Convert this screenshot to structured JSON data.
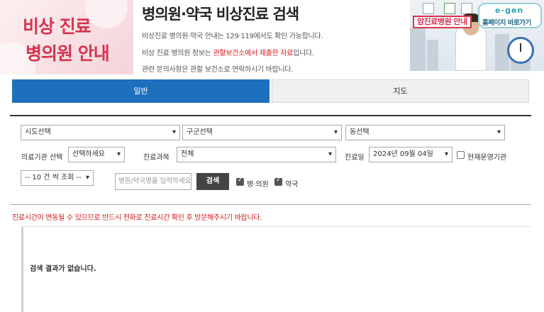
{
  "logo": {
    "line1": "비상 진료",
    "line2": "병의원 안내"
  },
  "title": "병의원·약국 비상진료 검색",
  "info": {
    "line1": "비상진료 병의원·약국 안내는 129·119에서도 확인 가능합니다.",
    "line2_before": "비상 진료 병의원 정보는 ",
    "line2_red": "관할보건소에서 제출한 자료",
    "line2_after": "입니다.",
    "line3": "관련 문의사항은 관할 보건소로 연락하시기 바랍니다."
  },
  "banner": {
    "cancer_label": "암진료병원 안내",
    "homepage_dots": "e-gen",
    "homepage_label": "홈페이지 바로가기"
  },
  "tabs": [
    {
      "label": "일반",
      "active": true
    },
    {
      "label": "지도",
      "active": false
    }
  ],
  "filters": {
    "sido": "시도선택",
    "gugun": "구군선택",
    "dong": "동선택",
    "institution_label": "의료기관 선택",
    "institution_value": "선택하세요",
    "department_label": "진료과목",
    "department_value": "전체",
    "date_label": "진료일",
    "date_value": "2024년 09월 04일",
    "operating_label": "현재운영기관",
    "operating_checked": false,
    "page_size": "-- 10 건 씩 조회 --",
    "search_placeholder": "병원/약국명을 입력하세요",
    "search_button": "검색",
    "hospital_label": "병·의원",
    "hospital_checked": true,
    "pharmacy_label": "약국",
    "pharmacy_checked": true
  },
  "notice": "진료시간이 변동될 수 있으므로 반드시 전화로 진료시간 확인 후 방문해주시기 바랍니다.",
  "result": {
    "empty_message": "검색 결과가 없습니다."
  },
  "colors": {
    "primary": "#1f6fbf",
    "alert": "#d81b1b",
    "logo": "#d8344f"
  }
}
